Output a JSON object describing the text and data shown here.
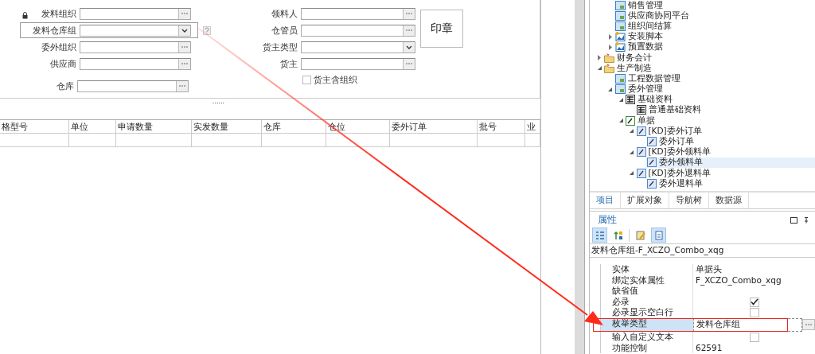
{
  "form": {
    "left_fields": [
      {
        "label": "发料组织",
        "kind": "lookup",
        "selected": false
      },
      {
        "label": "发料仓库组",
        "kind": "combo",
        "selected": true
      },
      {
        "label": "委外组织",
        "kind": "lookup",
        "selected": false
      },
      {
        "label": "供应商",
        "kind": "lookup",
        "selected": false
      },
      {
        "label": "仓库",
        "kind": "lookup",
        "selected": false
      }
    ],
    "right_fields": [
      {
        "label": "领料人",
        "kind": "lookup"
      },
      {
        "label": "仓管员",
        "kind": "lookup"
      },
      {
        "label": "货主类型",
        "kind": "combo"
      },
      {
        "label": "货主",
        "kind": "lookup"
      }
    ],
    "checkbox": {
      "label": "货主含组织",
      "checked": false
    },
    "stamp_button": "印章",
    "splitter": "......"
  },
  "grid": {
    "columns": [
      "格型号",
      "单位",
      "申请数量",
      "实发数量",
      "仓库",
      "仓位",
      "委外订单",
      "批号",
      "业"
    ]
  },
  "tree": {
    "items": [
      {
        "label": "销售管理",
        "kind": "module"
      },
      {
        "label": "供应商协同平台",
        "kind": "module"
      },
      {
        "label": "组织间结算",
        "kind": "module"
      },
      {
        "label": "安装脚本",
        "kind": "script",
        "expanded": false
      },
      {
        "label": "预置数据",
        "kind": "script",
        "expanded": false
      },
      {
        "label": "财务会计",
        "kind": "folder",
        "expanded": false
      },
      {
        "label": "生产制造",
        "kind": "folder",
        "expanded": true,
        "children": [
          {
            "label": "工程数据管理",
            "kind": "module"
          },
          {
            "label": "委外管理",
            "kind": "module",
            "expanded": true,
            "children": [
              {
                "label": "基础资料",
                "kind": "basedata",
                "expanded": true,
                "children": [
                  {
                    "label": "普通基础资料",
                    "kind": "basedata"
                  }
                ]
              },
              {
                "label": "单据",
                "kind": "bills",
                "expanded": true,
                "children": [
                  {
                    "label": "[KD]委外订单",
                    "kind": "bill",
                    "expanded": true,
                    "children": [
                      {
                        "label": "委外订单",
                        "kind": "bill",
                        "selected": false
                      }
                    ]
                  },
                  {
                    "label": "[KD]委外领料单",
                    "kind": "bill",
                    "expanded": true,
                    "children": [
                      {
                        "label": "委外领料单",
                        "kind": "bill",
                        "selected": true
                      }
                    ]
                  },
                  {
                    "label": "[KD]委外退料单",
                    "kind": "bill",
                    "expanded": true,
                    "children": [
                      {
                        "label": "委外退料单",
                        "kind": "bill",
                        "selected": false
                      }
                    ]
                  }
                ]
              }
            ]
          }
        ]
      }
    ]
  },
  "tabs": [
    {
      "label": "项目",
      "selected": true
    },
    {
      "label": "扩展对象",
      "selected": false
    },
    {
      "label": "导航树",
      "selected": false
    },
    {
      "label": "数据源",
      "selected": false
    }
  ],
  "properties": {
    "title": "属性",
    "toolbar": [
      {
        "kind": "categorized",
        "selected": true
      },
      {
        "kind": "sort",
        "selected": false
      },
      {
        "kind": "edit",
        "selected": false
      },
      {
        "kind": "pages",
        "selected": true
      }
    ],
    "path": "发料仓库组-F_XCZO_Combo_xqg",
    "rows": [
      {
        "name": "实体",
        "kind": "text",
        "value": "单据头",
        "selected": false
      },
      {
        "name": "绑定实体属性",
        "kind": "text",
        "value": "F_XCZO_Combo_xqg",
        "selected": false
      },
      {
        "name": "缺省值",
        "kind": "text",
        "selected": false
      },
      {
        "name": "必录",
        "kind": "check",
        "checked": true,
        "selected": false
      },
      {
        "name": "必录显示空白行",
        "kind": "check",
        "checked": false,
        "selected": false
      },
      {
        "name": "枚举类型",
        "kind": "lookup",
        "value": "发料仓库组",
        "selected": true
      },
      {
        "name": "输入自定义文本",
        "kind": "check",
        "checked": false,
        "selected": false
      },
      {
        "name": "功能控制",
        "kind": "text",
        "value": "62591",
        "selected": false
      }
    ]
  }
}
